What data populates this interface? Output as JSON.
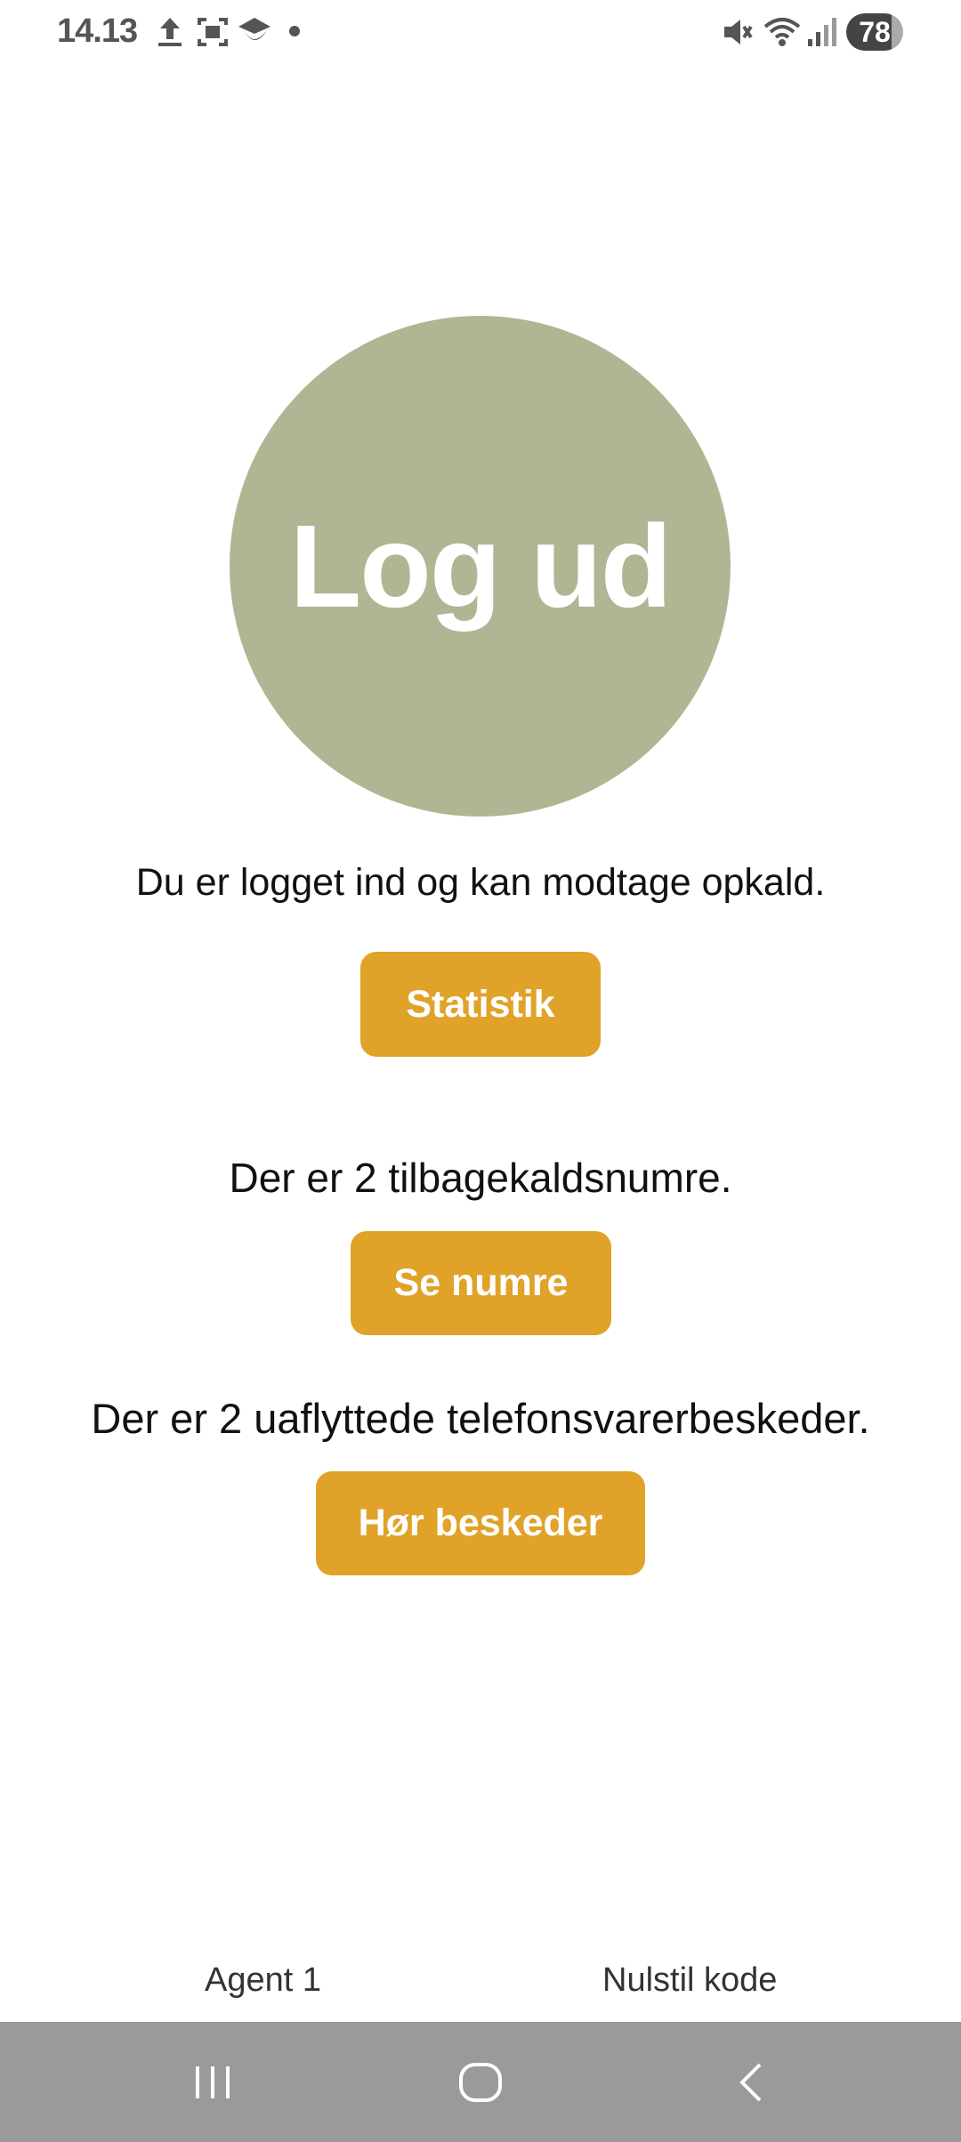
{
  "status_bar": {
    "time": "14.13",
    "battery_level": "78",
    "icons": [
      "upload-icon",
      "screenshot-icon",
      "app-notification-icon",
      "dot-icon",
      "mute-icon",
      "wifi-icon",
      "signal-icon"
    ]
  },
  "main": {
    "logout_label": "Log ud",
    "logged_in_text": "Du er logget ind og kan modtage opkald.",
    "statistics_button": "Statistik",
    "callbacks_text": "Der er 2 tilbagekaldsnumre.",
    "see_numbers_button": "Se numre",
    "voicemail_text": "Der er 2 uaflyttede telefonsvarerbeskeder.",
    "listen_button": "Hør beskeder"
  },
  "footer": {
    "agent_label": "Agent 1",
    "reset_code_label": "Nulstil kode"
  },
  "colors": {
    "logout_circle": "#aeb693",
    "accent_button": "#e0a228",
    "nav_bar": "#9a9a9a"
  },
  "nav": [
    "recent-apps-icon",
    "home-icon",
    "back-icon"
  ]
}
